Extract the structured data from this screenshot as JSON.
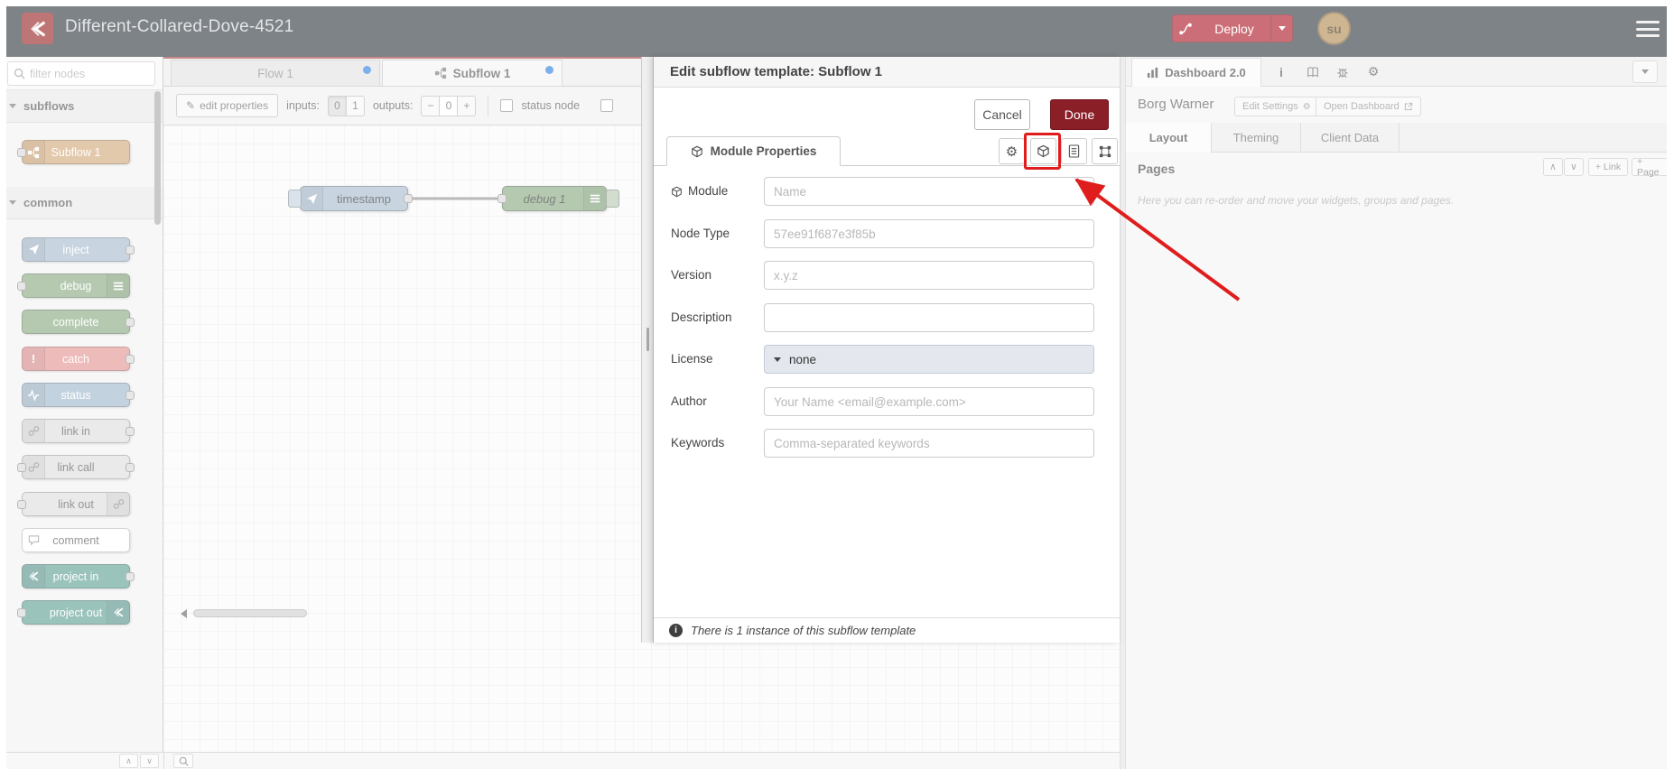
{
  "colors": {
    "header_bg": "#30383e",
    "brand_red": "#ad1625",
    "done_red": "#8b1f28",
    "annotation_red": "#e01d1d",
    "dirty_dot_blue": "#2d7fe0"
  },
  "header": {
    "title": "Different-Collared-Dove-4521",
    "deploy_label": "Deploy",
    "user_initials": "su"
  },
  "palette": {
    "filter_placeholder": "filter nodes",
    "category_subflows": "subflows",
    "category_common": "common",
    "nodes": [
      {
        "label": "Subflow 1",
        "color": "#d2a878"
      },
      {
        "label": "inject",
        "color": "#a6bbcf"
      },
      {
        "label": "debug",
        "color": "#87a980"
      },
      {
        "label": "complete",
        "color": "#87a980"
      },
      {
        "label": "catch",
        "color": "#e49191"
      },
      {
        "label": "status",
        "color": "#9fb7cc"
      },
      {
        "label": "link in",
        "color": "#dddddd"
      },
      {
        "label": "link call",
        "color": "#dddddd"
      },
      {
        "label": "link out",
        "color": "#dddddd"
      },
      {
        "label": "comment",
        "color": "#ffffff"
      },
      {
        "label": "project in",
        "color": "#5d9e94"
      },
      {
        "label": "project out",
        "color": "#5d9e94"
      }
    ]
  },
  "workspace": {
    "tabs": [
      {
        "label": "Flow 1"
      },
      {
        "label": "Subflow 1"
      }
    ],
    "toolbar": {
      "edit_properties": "edit properties",
      "inputs_label": "inputs:",
      "inputs_options": [
        "0",
        "1"
      ],
      "outputs_label": "outputs:",
      "outputs_minus": "−",
      "outputs_value": "0",
      "outputs_plus": "+",
      "status_node": "status node"
    },
    "nodes": [
      {
        "label": "timestamp",
        "color": "#a6bbcf"
      },
      {
        "label": "debug 1",
        "color": "#87a980"
      }
    ]
  },
  "tray": {
    "title": "Edit subflow template: Subflow 1",
    "cancel": "Cancel",
    "done": "Done",
    "active_tab": "Module Properties",
    "fields": {
      "module": {
        "label": "Module",
        "placeholder": "Name"
      },
      "node_type": {
        "label": "Node Type",
        "placeholder": "57ee91f687e3f85b"
      },
      "version": {
        "label": "Version",
        "placeholder": "x.y.z"
      },
      "description": {
        "label": "Description",
        "placeholder": ""
      },
      "license": {
        "label": "License",
        "value": "none"
      },
      "author": {
        "label": "Author",
        "placeholder": "Your Name <email@example.com>"
      },
      "keywords": {
        "label": "Keywords",
        "placeholder": "Comma-separated keywords"
      }
    },
    "footer": "There is 1 instance of this subflow template"
  },
  "sidebar": {
    "dashboard_tab": "Dashboard 2.0",
    "project_name": "Borg Warner",
    "edit_settings": "Edit Settings",
    "open_dashboard": "Open Dashboard",
    "tabs": [
      "Layout",
      "Theming",
      "Client Data"
    ],
    "pages_title": "Pages",
    "add_link": "+ Link",
    "add_page": "+ Page",
    "help_text": "Here you can re-order and move your widgets, groups and pages."
  },
  "icons": {
    "gear": "⚙",
    "pencil": "✎",
    "caret_up": "∧",
    "caret_down": "∨",
    "info": "i"
  }
}
